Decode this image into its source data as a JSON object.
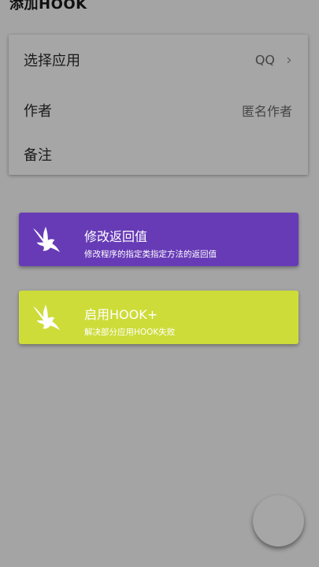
{
  "header": {
    "title": "添加HOOK"
  },
  "form": {
    "app_label": "选择应用",
    "app_value": "QQ",
    "author_label": "作者",
    "author_value": "匿名作者",
    "note_label": "备注"
  },
  "actions": [
    {
      "title": "修改返回值",
      "subtitle": "修改程序的指定类指定方法的返回值",
      "color": "#673bb6",
      "icon": "eagle-icon"
    },
    {
      "title": "启用HOOK+",
      "subtitle": "解决部分应用HOOK失败",
      "color": "#cddc39",
      "icon": "eagle-icon"
    }
  ]
}
